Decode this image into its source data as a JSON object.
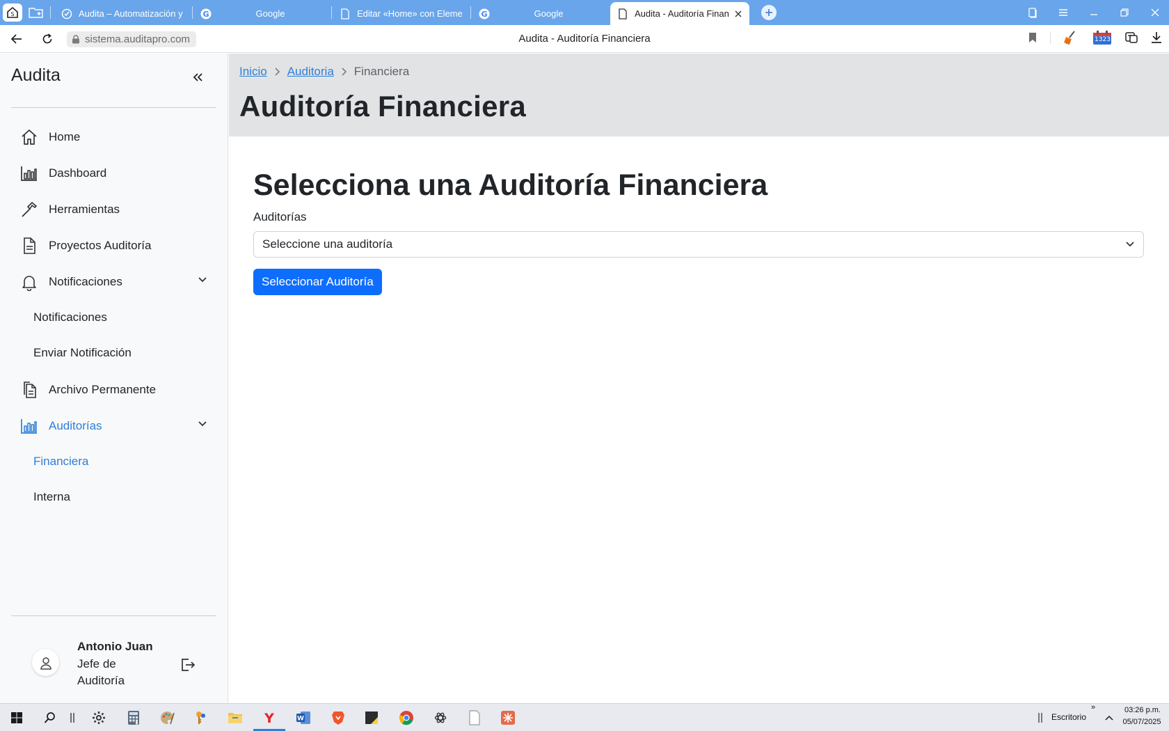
{
  "browser": {
    "tabs": [
      {
        "title": "Audita – Automatización y",
        "icon": "audita-check-icon"
      },
      {
        "title": "Google",
        "icon": "google-icon"
      },
      {
        "title": "Editar «Home» con Elemen",
        "icon": "page-icon"
      },
      {
        "title": "Google",
        "icon": "google-icon"
      },
      {
        "title": "Audita - Auditoría Finan",
        "icon": "page-icon",
        "active": true
      }
    ],
    "url": "sistema.auditapro.com",
    "page_title": "Audita - Auditoría Financiera",
    "calendar_badge": "1323"
  },
  "sidebar": {
    "brand": "Audita",
    "items": [
      {
        "label": "Home",
        "icon": "home-icon"
      },
      {
        "label": "Dashboard",
        "icon": "bar-chart-icon"
      },
      {
        "label": "Herramientas",
        "icon": "hammer-icon"
      },
      {
        "label": "Proyectos Auditoría",
        "icon": "document-icon"
      },
      {
        "label": "Notificaciones",
        "icon": "bell-icon",
        "expanded": true
      },
      {
        "label": "Archivo Permanente",
        "icon": "files-icon"
      },
      {
        "label": "Auditorías",
        "icon": "bar-chart-icon",
        "expanded": true,
        "active": true
      }
    ],
    "notificaciones_sub": [
      "Notificaciones",
      "Enviar Notificación"
    ],
    "auditorias_sub": [
      "Financiera",
      "Interna"
    ],
    "user": {
      "name": "Antonio Juan",
      "role": "Jefe de Auditoría"
    }
  },
  "main": {
    "breadcrumb": {
      "home": "Inicio",
      "section": "Auditoria",
      "current": "Financiera"
    },
    "page_title": "Auditoría Financiera",
    "section_title": "Selecciona una Auditoría Financiera",
    "select_label": "Auditorías",
    "select_value": "Seleccione una auditoría",
    "button_label": "Seleccionar Auditoría"
  },
  "taskbar": {
    "desktop_label": "Escritorio",
    "time": "03:26 p.m.",
    "date": "05/07/2025"
  },
  "colors": {
    "accent": "#2d7fd8",
    "primary": "#0d6efd",
    "tabstrip": "#69a5ea",
    "header_band": "#e2e3e5"
  }
}
